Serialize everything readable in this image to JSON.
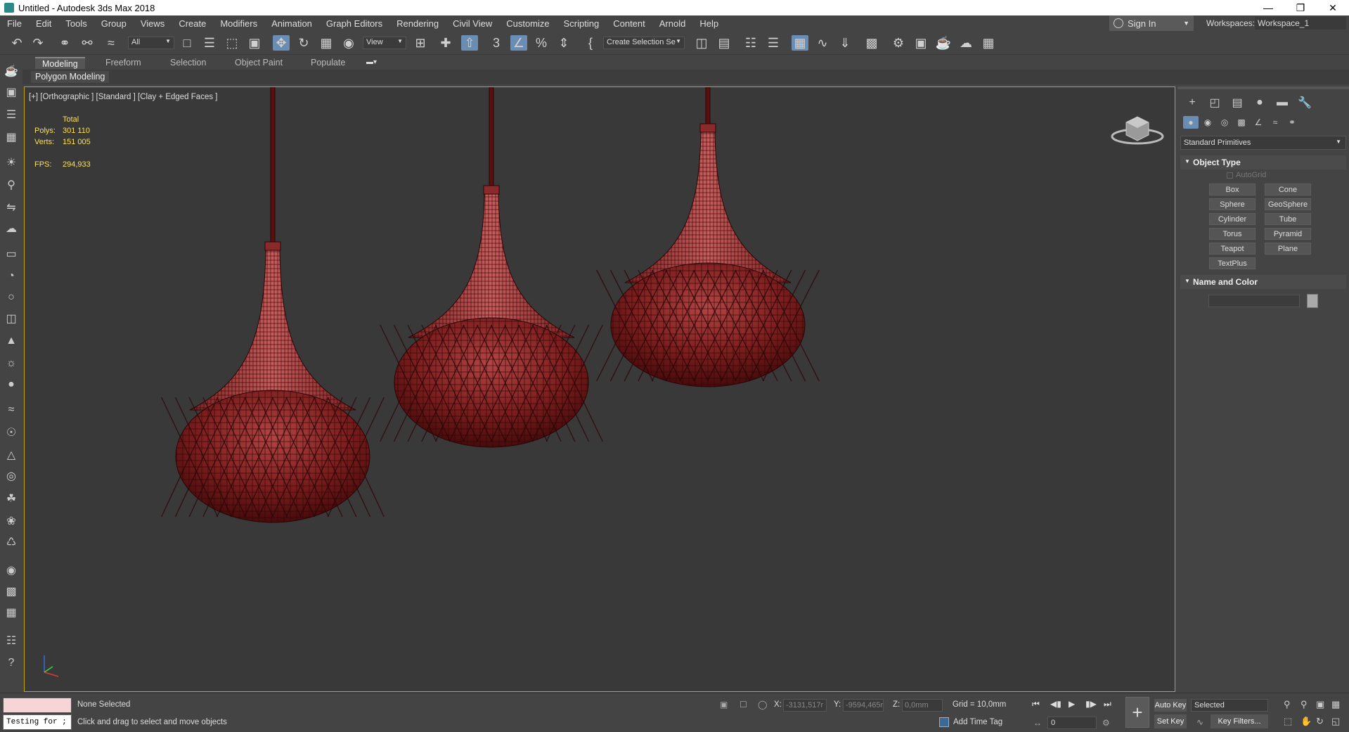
{
  "window": {
    "title": "Untitled - Autodesk 3ds Max 2018",
    "controls": [
      "—",
      "❐",
      "✕"
    ]
  },
  "menu": [
    "File",
    "Edit",
    "Tools",
    "Group",
    "Views",
    "Create",
    "Modifiers",
    "Animation",
    "Graph Editors",
    "Rendering",
    "Civil View",
    "Customize",
    "Scripting",
    "Content",
    "Arnold",
    "Help"
  ],
  "account": {
    "sign_in": "Sign In",
    "workspaces_label": "Workspaces:",
    "workspace": "Workspace_1"
  },
  "toolbar": {
    "filter": "All",
    "ref_coord": "View",
    "selection_set": "Create Selection Se"
  },
  "ribbon": {
    "tabs": [
      "Modeling",
      "Freeform",
      "Selection",
      "Object Paint",
      "Populate"
    ],
    "sub_panel": "Polygon Modeling"
  },
  "viewport": {
    "label": "[+] [Orthographic ] [Standard ] [Clay + Edged Faces ]",
    "stats": {
      "total": "Total",
      "polys_label": "Polys:",
      "polys": "301 110",
      "verts_label": "Verts:",
      "verts": "151 005",
      "fps_label": "FPS:",
      "fps": "294,933"
    },
    "mesh_color": "#8a2020",
    "wire_color": "#2a0505"
  },
  "command_panel": {
    "category": "Standard Primitives",
    "object_type_title": "Object Type",
    "autogrid": "AutoGrid",
    "buttons": [
      "Box",
      "Cone",
      "Sphere",
      "GeoSphere",
      "Cylinder",
      "Tube",
      "Torus",
      "Pyramid",
      "Teapot",
      "Plane",
      "TextPlus"
    ],
    "name_color_title": "Name and Color"
  },
  "status": {
    "script_text": "Testing for ;",
    "selection": "None Selected",
    "prompt": "Click and drag to select and move objects",
    "x_label": "X:",
    "x": "-3131,517r",
    "y_label": "Y:",
    "y": "-9594,465r",
    "z_label": "Z:",
    "z": "0,0mm",
    "grid": "Grid = 10,0mm",
    "add_time_tag": "Add Time Tag",
    "frame": "0",
    "auto_key": "Auto Key",
    "set_key": "Set Key",
    "key_mode": "Selected",
    "key_filters": "Key Filters..."
  }
}
